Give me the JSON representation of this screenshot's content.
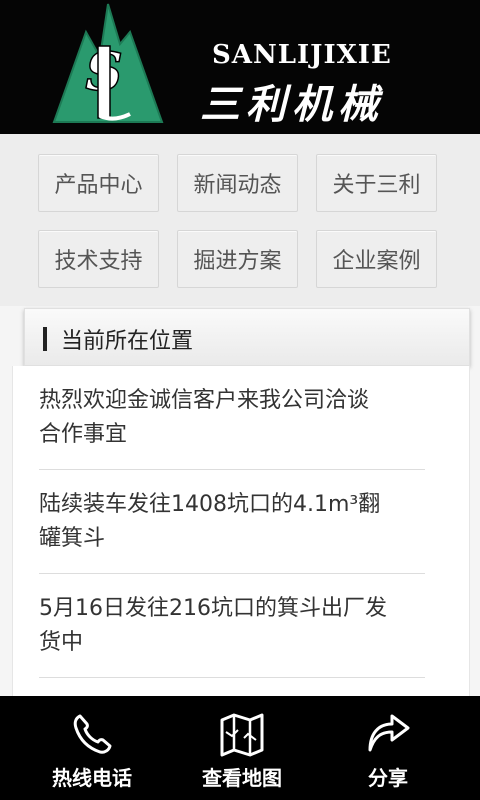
{
  "header": {
    "brand_en": "SANLIJIXIE",
    "brand_cn": "三利机械",
    "logo_letters": "SL"
  },
  "nav": {
    "items": [
      {
        "label": "产品中心"
      },
      {
        "label": "新闻动态"
      },
      {
        "label": "关于三利"
      },
      {
        "label": "技术支持"
      },
      {
        "label": "掘进方案"
      },
      {
        "label": "企业案例"
      }
    ]
  },
  "location": {
    "label": "当前所在位置"
  },
  "news": {
    "items": [
      {
        "line1": "热烈欢迎金诚信客户来我公司洽谈",
        "line2": "合作事宜"
      },
      {
        "line1": "陆续装车发往1408坑口的4.1m³翻",
        "line2": "罐箕斗"
      },
      {
        "line1": "5月16日发往216坑口的箕斗出厂发",
        "line2": "货中"
      }
    ]
  },
  "bottom_bar": {
    "tabs": [
      {
        "label": "热线电话",
        "icon": "phone-icon"
      },
      {
        "label": "查看地图",
        "icon": "map-icon"
      },
      {
        "label": "分享",
        "icon": "share-icon"
      }
    ]
  },
  "colors": {
    "header_bg": "#050505",
    "logo_green": "#2a9a6e",
    "nav_bg": "#ededed",
    "bottom_bg": "#000000"
  }
}
